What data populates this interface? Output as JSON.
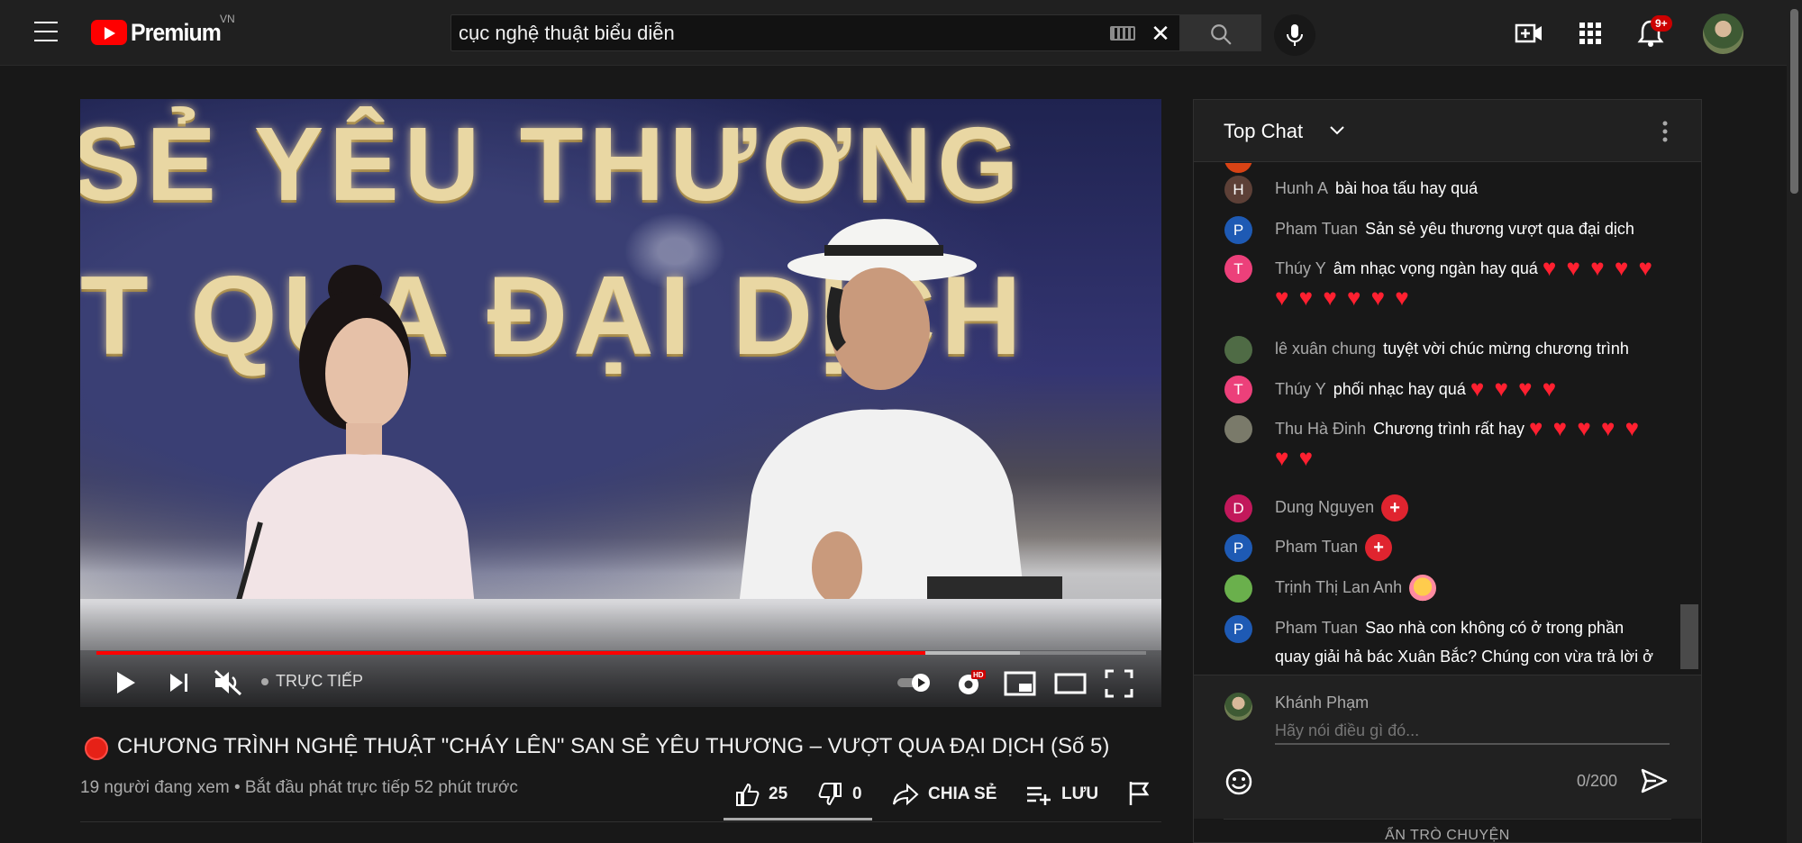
{
  "masthead": {
    "logo_text": "Premium",
    "country_code": "VN",
    "search_value": "cục nghệ thuật biểu diễn",
    "notification_count": "9+"
  },
  "player": {
    "banner_line1": "SẺ YÊU THƯƠNG",
    "banner_line2": "T QUA ĐẠI DỊCH",
    "live_label": "TRỰC TIẾP",
    "progress_played": 0.79,
    "progress_buffered": 0.88
  },
  "video": {
    "title": "CHƯƠNG TRÌNH NGHỆ THUẬT \"CHÁY LÊN\" SAN SẺ YÊU THƯƠNG – VƯỢT QUA ĐẠI DỊCH (Số 5)",
    "meta": "19 người đang xem • Bắt đầu phát trực tiếp 52 phút trước",
    "likes": "25",
    "dislikes": "0",
    "share_label": "CHIA SẺ",
    "save_label": "LƯU"
  },
  "chat": {
    "header_title": "Top Chat",
    "messages": [
      {
        "initial": "H",
        "color": "#5d4037",
        "author": "Hunh A",
        "text": "bài hoa tấu hay quá",
        "extra": ""
      },
      {
        "initial": "P",
        "color": "#1e5ab4",
        "author": "Pham Tuan",
        "text": "Sản sẻ yêu thương vượt qua đại dịch",
        "extra": ""
      },
      {
        "initial": "T",
        "color": "#ec407a",
        "author": "Thúy Y",
        "text": "âm nhạc vọng ngàn hay quá",
        "extra": "❤️ ❤️ ❤️ ❤️ ❤️ ❤️ ❤️ ❤️ ❤️ ❤️ ❤️"
      },
      {
        "initial": "",
        "color": "#4f6b45",
        "author": "lê xuân chung",
        "text": "tuyệt vời chúc mừng chương trình",
        "extra": ""
      },
      {
        "initial": "T",
        "color": "#ec407a",
        "author": "Thúy Y",
        "text": "phối nhạc hay quá",
        "extra": "❤️ ❤️ ❤️ ❤️"
      },
      {
        "initial": "",
        "color": "#7a7a6a",
        "author": "Thu Hà Đinh",
        "text": "Chương trình rất hay",
        "extra": "❤️ ❤️ ❤️ ❤️ ❤️ ❤️ ❤️"
      },
      {
        "initial": "D",
        "color": "#c2185b",
        "author": "Dung Nguyen",
        "text": "",
        "extra": "+"
      },
      {
        "initial": "P",
        "color": "#1e5ab4",
        "author": "Pham Tuan",
        "text": "",
        "extra": "+"
      },
      {
        "initial": "",
        "color": "#6ab04c",
        "author": "Trịnh Thị Lan Anh",
        "text": "",
        "extra": "hug"
      },
      {
        "initial": "P",
        "color": "#1e5ab4",
        "author": "Pham Tuan",
        "text": "Sao nhà con không có ở trong phần quay giải hả bác Xuân Bắc? Chúng con vừa trả lời ở nich Dung Nguyen ạ",
        "extra": ""
      }
    ],
    "input_user": "Khánh Phạm",
    "input_placeholder": "Hãy nói điều gì đó...",
    "char_count": "0/200",
    "hide_label": "ẨN TRÒ CHUYỆN"
  }
}
